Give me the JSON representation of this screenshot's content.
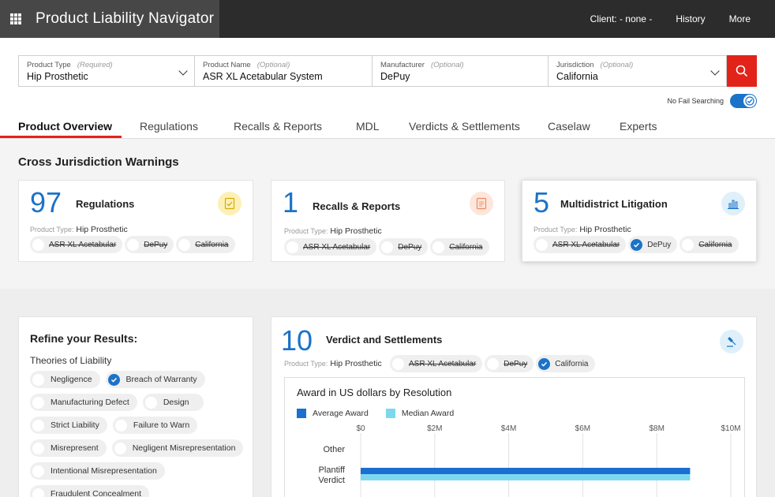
{
  "app": {
    "title": "Product Liability Navigator"
  },
  "topnav": {
    "client": "Client: - none -",
    "history": "History",
    "more": "More"
  },
  "search": {
    "product_type": {
      "label": "Product Type",
      "hint": "(Required)",
      "value": "Hip Prosthetic"
    },
    "product_name": {
      "label": "Product Name",
      "hint": "(Optional)",
      "value": "ASR XL Acetabular System"
    },
    "manufacturer": {
      "label": "Manufacturer",
      "hint": "(Optional)",
      "value": "DePuy"
    },
    "jurisdiction": {
      "label": "Jurisdiction",
      "hint": "(Optional)",
      "value": "California"
    }
  },
  "no_fail": {
    "label": "No Fail Searching",
    "on": true
  },
  "tabs": [
    "Product Overview",
    "Regulations",
    "Recalls & Reports",
    "MDL",
    "Verdicts & Settlements",
    "Caselaw",
    "Experts"
  ],
  "warnings": {
    "title": "Cross Jurisdiction Warnings",
    "ptype_label": "Product Type:",
    "ptype_value": "Hip Prosthetic",
    "cards": [
      {
        "count": "97",
        "title": "Regulations",
        "icon": "checklist-icon",
        "chips": [
          {
            "label": "ASR XL Acetabular",
            "checked": false
          },
          {
            "label": "DePuy",
            "checked": false
          },
          {
            "label": "California",
            "checked": false
          }
        ]
      },
      {
        "count": "1",
        "title": "Recalls & Reports",
        "icon": "document-icon",
        "chips": [
          {
            "label": "ASR XL Acetabular",
            "checked": false
          },
          {
            "label": "DePuy",
            "checked": false
          },
          {
            "label": "California",
            "checked": false
          }
        ]
      },
      {
        "count": "5",
        "title": "Multidistrict Litigation",
        "icon": "bar-chart-icon",
        "chips": [
          {
            "label": "ASR XL Acetabular",
            "checked": false
          },
          {
            "label": "DePuy",
            "checked": true
          },
          {
            "label": "California",
            "checked": false
          }
        ]
      }
    ]
  },
  "refine": {
    "title": "Refine your Results:",
    "subtitle": "Theories of Liability",
    "rows": [
      [
        {
          "label": "Negligence",
          "checked": false
        },
        {
          "label": "Breach of Warranty",
          "checked": true
        }
      ],
      [
        {
          "label": "Manufacturing Defect",
          "checked": false
        },
        {
          "label": "Design",
          "checked": false
        }
      ],
      [
        {
          "label": "Strict Liability",
          "checked": false
        },
        {
          "label": "Failure to Warn",
          "checked": false
        }
      ],
      [
        {
          "label": "Misrepresent",
          "checked": false
        },
        {
          "label": "Negligent Misrepresentation",
          "checked": false
        }
      ],
      [
        {
          "label": "Intentional Misrepresentation",
          "checked": false
        }
      ],
      [
        {
          "label": "Fraudulent Concealment",
          "checked": false
        }
      ]
    ]
  },
  "verdicts": {
    "count": "10",
    "title": "Verdict and Settlements",
    "icon": "gavel-icon",
    "ptype_label": "Product Type:",
    "ptype_value": "Hip Prosthetic",
    "chips": [
      {
        "label": "ASR XL Acetabular",
        "checked": false
      },
      {
        "label": "DePuy",
        "checked": false
      },
      {
        "label": "California",
        "checked": true
      }
    ]
  },
  "chart_data": {
    "type": "bar",
    "orientation": "horizontal",
    "title": "Award in US dollars by Resolution",
    "categories": [
      "Other",
      "Plantiff Verdict"
    ],
    "series": [
      {
        "name": "Average Award",
        "color": "#1a6fd1",
        "values": [
          0,
          8900000
        ]
      },
      {
        "name": "Median Award",
        "color": "#7dd8ee",
        "values": [
          0,
          8900000
        ]
      }
    ],
    "xticks": [
      "$0",
      "$2M",
      "$4M",
      "$6M",
      "$8M",
      "$10M"
    ],
    "xlim": [
      0,
      10000000
    ],
    "grid": true,
    "legend": "top-left"
  }
}
